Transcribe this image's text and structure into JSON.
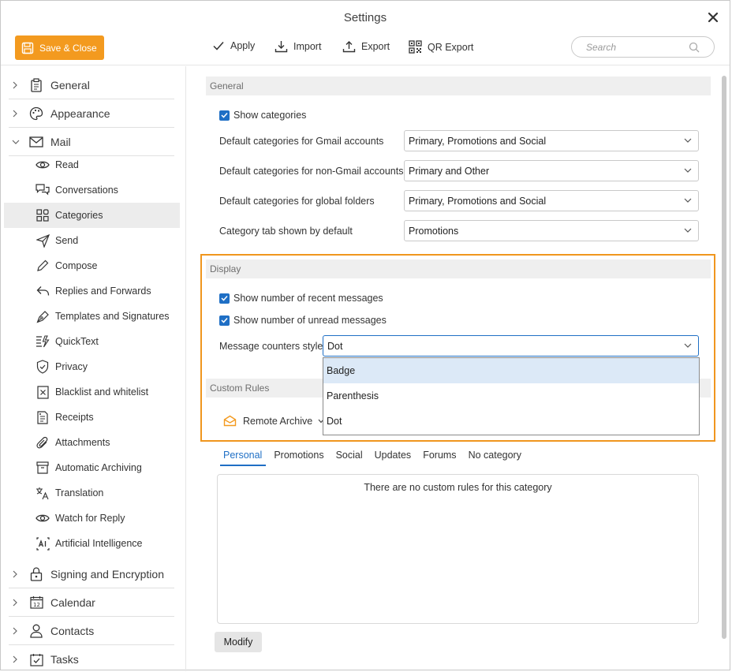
{
  "window": {
    "title": "Settings"
  },
  "toolbar": {
    "save_close": "Save & Close",
    "apply": "Apply",
    "import": "Import",
    "export": "Export",
    "qr_export": "QR Export",
    "search_placeholder": "Search"
  },
  "sidebar": {
    "categories": {
      "general": "General",
      "appearance": "Appearance",
      "mail": "Mail",
      "signing": "Signing and Encryption",
      "calendar": "Calendar",
      "contacts": "Contacts",
      "tasks": "Tasks"
    },
    "mail_items": [
      {
        "label": "Read",
        "icon": "eye-icon"
      },
      {
        "label": "Conversations",
        "icon": "conversations-icon"
      },
      {
        "label": "Categories",
        "icon": "categories-grid-icon",
        "active": true
      },
      {
        "label": "Send",
        "icon": "send-icon"
      },
      {
        "label": "Compose",
        "icon": "pencil-icon"
      },
      {
        "label": "Replies and Forwards",
        "icon": "reply-icon"
      },
      {
        "label": "Templates and Signatures",
        "icon": "pen-nib-icon"
      },
      {
        "label": "QuickText",
        "icon": "quicktext-icon"
      },
      {
        "label": "Privacy",
        "icon": "shield-icon"
      },
      {
        "label": "Blacklist and whitelist",
        "icon": "blacklist-icon"
      },
      {
        "label": "Receipts",
        "icon": "receipt-icon"
      },
      {
        "label": "Attachments",
        "icon": "paperclip-icon"
      },
      {
        "label": "Automatic Archiving",
        "icon": "archive-box-icon"
      },
      {
        "label": "Translation",
        "icon": "translate-icon"
      },
      {
        "label": "Watch for Reply",
        "icon": "eye-icon"
      },
      {
        "label": "Artificial Intelligence",
        "icon": "ai-icon"
      }
    ]
  },
  "general_section": {
    "header": "General",
    "show_categories": "Show categories",
    "gmail_label": "Default categories for Gmail accounts",
    "gmail_value": "Primary, Promotions and Social",
    "non_gmail_label": "Default categories for non-Gmail accounts",
    "non_gmail_value": "Primary and Other",
    "global_label": "Default categories for global folders",
    "global_value": "Primary, Promotions and Social",
    "default_tab_label": "Category tab shown by default",
    "default_tab_value": "Promotions"
  },
  "display_section": {
    "header": "Display",
    "show_recent": "Show number of recent messages",
    "show_unread": "Show number of unread messages",
    "counter_style_label": "Message counters style",
    "counter_style_value": "Dot",
    "counter_style_options": [
      "Badge",
      "Parenthesis",
      "Dot"
    ]
  },
  "custom_rules": {
    "header": "Custom Rules",
    "account": "Remote Archive",
    "tabs": [
      "Personal",
      "Promotions",
      "Social",
      "Updates",
      "Forums",
      "No category"
    ],
    "active_tab": "Personal",
    "empty_message": "There are no custom rules for this category",
    "modify": "Modify"
  },
  "colors": {
    "accent": "#f39a1f",
    "blue": "#1f6fc5",
    "highlight_border": "#f0961e"
  }
}
